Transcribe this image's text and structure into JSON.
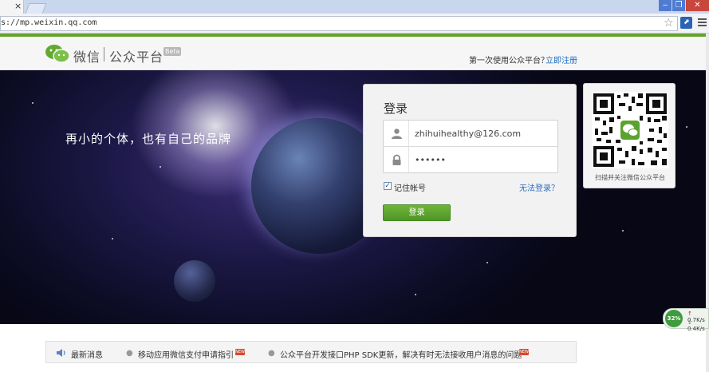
{
  "browser": {
    "tab_close": "×",
    "url": "s://mp.weixin.qq.com"
  },
  "header": {
    "logo_text": "微信",
    "logo_sub": "公众平台",
    "beta": "Beta",
    "first_time_text": "第一次使用公众平台？",
    "register_link": "立即注册"
  },
  "hero": {
    "slogan": "再小的个体，也有自己的品牌"
  },
  "login": {
    "title": "登录",
    "username_value": "zhihuihealthy@126.com",
    "password_value": "••••••",
    "remember_label": "记住帐号",
    "remember_checked": "✓",
    "cant_login": "无法登录？",
    "submit_label": "登录"
  },
  "qr": {
    "caption": "扫描并关注微信公众平台"
  },
  "news": {
    "label": "最新消息",
    "items": [
      {
        "text": "移动应用微信支付申请指引",
        "badge": "NEW"
      },
      {
        "text": "公众平台开发接口PHP SDK更新，解决有时无法接收用户消息的问题",
        "badge": "NEW"
      }
    ]
  },
  "speed": {
    "percent": "32%",
    "up": "0.7K/s",
    "down": "0.4K/s"
  },
  "colors": {
    "brand_green": "#66a32c",
    "link_blue": "#1f6dc4",
    "button_green": "#5aa32e"
  }
}
